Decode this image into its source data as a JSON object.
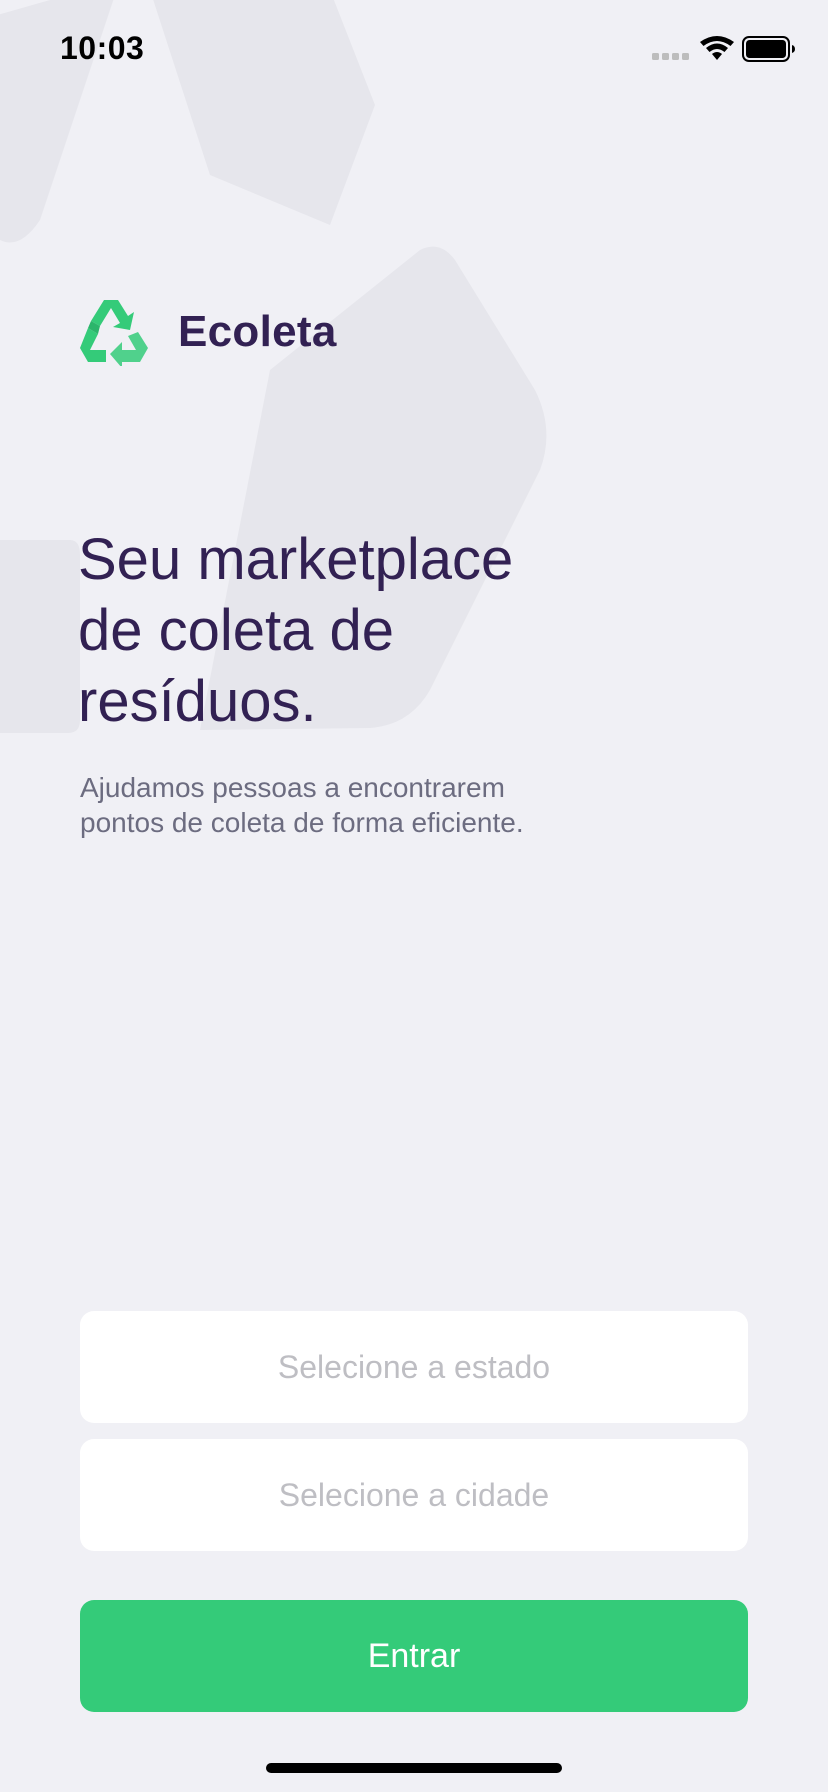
{
  "status_bar": {
    "time": "10:03"
  },
  "brand": {
    "name": "Ecoleta",
    "icon": "recycle-icon"
  },
  "hero": {
    "title_lines": [
      "Seu marketplace",
      "de coleta de",
      "resíduos."
    ],
    "description_lines": [
      "Ajudamos pessoas a encontrarem",
      "pontos de coleta de forma eficiente."
    ]
  },
  "form": {
    "state_placeholder": "Selecione a estado",
    "city_placeholder": "Selecione a cidade",
    "submit_label": "Entrar"
  },
  "colors": {
    "background": "#F0F0F5",
    "title": "#322153",
    "text": "#6C6C80",
    "accent": "#34CB79",
    "placeholder": "#BEBEC3"
  }
}
